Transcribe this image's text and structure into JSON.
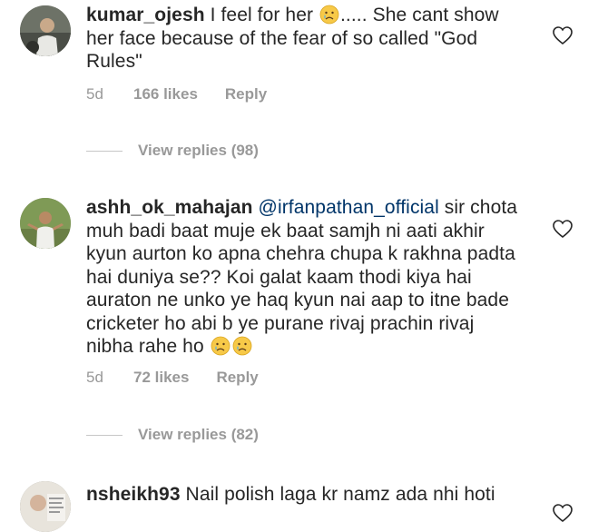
{
  "comments": [
    {
      "username": "kumar_ojesh",
      "mention": "",
      "text_before_emoji": " I feel for her ",
      "emoji_1": "crying-face",
      "text_after_emoji": "..... She cant show her face because of the fear of so called \"God Rules\"",
      "time": "5d",
      "likes": "166 likes",
      "reply": "Reply",
      "view_replies": "View replies (98)"
    },
    {
      "username": "ashh_ok_mahajan",
      "mention": "@irfanpathan_official",
      "text_before_emoji": " sir chota muh badi baat muje ek baat samjh ni aati akhir kyun aurton ko apna chehra chupa k rakhna padta hai duniya se?? Koi galat kaam thodi kiya hai auraton ne unko ye haq kyun nai aap to itne bade cricketer ho abi b ye purane rivaj prachin rivaj nibha rahe ho ",
      "emoji_1": "crying-face",
      "emoji_2": "crying-face",
      "time": "5d",
      "likes": "72 likes",
      "reply": "Reply",
      "view_replies": "View replies (82)"
    },
    {
      "username": "nsheikh93",
      "text": " Nail polish laga kr namz ada nhi hoti"
    }
  ],
  "colors": {
    "text": "#262626",
    "meta": "#999999",
    "mention": "#003569"
  }
}
